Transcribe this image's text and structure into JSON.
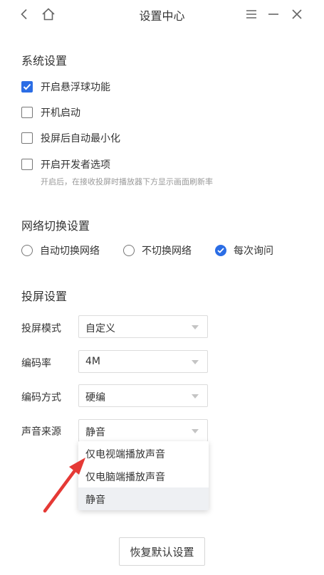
{
  "window": {
    "title": "设置中心",
    "back_icon": "chevron-left-icon",
    "home_icon": "home-icon",
    "menu_icon": "menu-icon",
    "minimize_icon": "minimize-icon",
    "close_icon": "close-icon"
  },
  "system": {
    "title": "系统设置",
    "items": [
      {
        "label": "开启悬浮球功能",
        "checked": true
      },
      {
        "label": "开机启动",
        "checked": false
      },
      {
        "label": "投屏后自动最小化",
        "checked": false
      },
      {
        "label": "开启开发者选项",
        "checked": false
      }
    ],
    "developer_hint": "开启后，在接收投屏时播放器下方显示画面刷新率"
  },
  "network": {
    "title": "网络切换设置",
    "options": [
      {
        "label": "自动切换网络",
        "checked": false
      },
      {
        "label": "不切换网络",
        "checked": false
      },
      {
        "label": "每次询问",
        "checked": true
      }
    ]
  },
  "projection": {
    "title": "投屏设置",
    "fields": [
      {
        "label": "投屏模式",
        "value": "自定义"
      },
      {
        "label": "编码率",
        "value": "4M"
      },
      {
        "label": "编码方式",
        "value": "硬编"
      },
      {
        "label": "声音来源",
        "value": "静音"
      }
    ],
    "sound_options": [
      "仅电视端播放声音",
      "仅电脑端播放声音",
      "静音"
    ],
    "sound_selected": "静音"
  },
  "reset_label": "恢复默认设置",
  "colors": {
    "accent": "#2b6de5",
    "annotation_arrow": "#e53935"
  }
}
